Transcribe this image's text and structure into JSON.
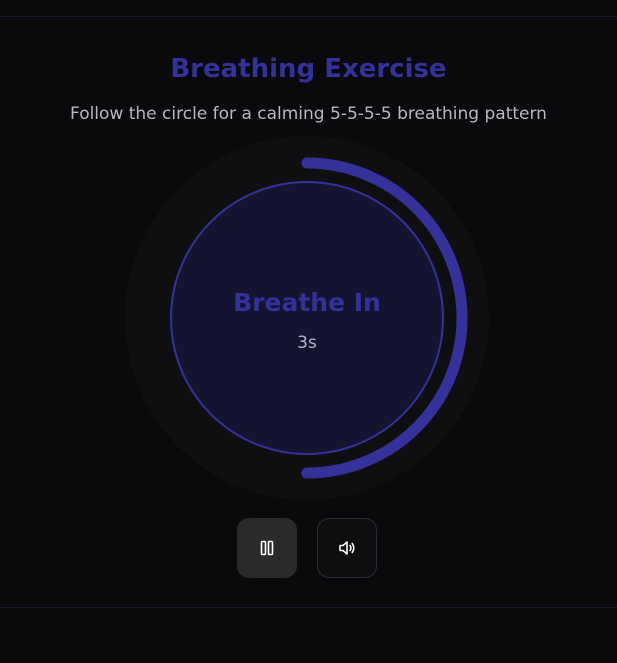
{
  "header": {
    "title": "Breathing Exercise",
    "subtitle": "Follow the circle for a calming 5-5-5-5 breathing pattern"
  },
  "breathing": {
    "phase": "Breathe In",
    "countdown": "3s",
    "progress": 0.5
  },
  "controls": {
    "pause_icon": "pause-icon",
    "sound_icon": "speaker-icon"
  },
  "colors": {
    "accent": "#34319b",
    "background": "#0a0a0c",
    "circle_fill": "#141430",
    "text_muted": "#b7b7c2"
  }
}
